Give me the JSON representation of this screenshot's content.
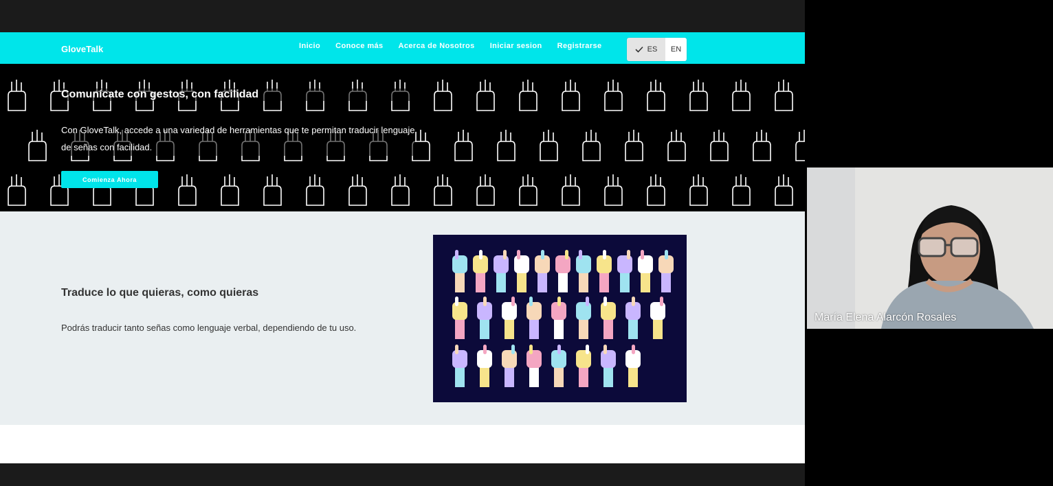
{
  "site": {
    "brand": "GloveTalk",
    "nav": [
      "Inicio",
      "Conoce más",
      "Acerca de Nosotros",
      "Iniciar sesion",
      "Registrarse"
    ],
    "lang": {
      "es": "ES",
      "en": "EN",
      "selected": "ES"
    }
  },
  "hero": {
    "title": "Comunícate con gestos, con facilidad",
    "description": "Con GloveTalk, accede a una variedad de herramientas que te permitan traducir lenguaje de señas con facilidad.",
    "cta": "Comienza Ahora"
  },
  "feature": {
    "title": "Traduce lo que quieras, como quieras",
    "description": "Podrás traducir tanto señas como lenguaje verbal, dependiendo de tu uso."
  },
  "video": {
    "participant_name": "María Elena Alarcón Rosales"
  },
  "colors": {
    "accent": "#00e5ea",
    "hero_bg": "#000000",
    "feature_bg": "#eaeff1",
    "image_bg": "#0c0a3a"
  }
}
